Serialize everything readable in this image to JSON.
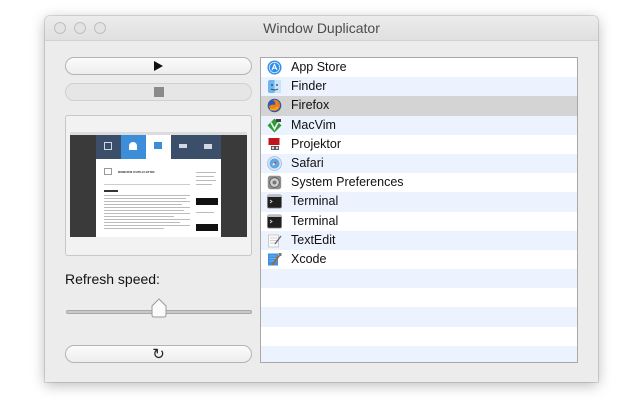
{
  "window": {
    "title": "Window Duplicator"
  },
  "controls": {
    "play_icon": "play-icon",
    "stop_icon": "stop-icon",
    "refresh_icon": "refresh-icon",
    "refresh_label": "Refresh speed:",
    "refresh_speed_fraction": 0.5
  },
  "preview": {
    "heading": "WINDOW DUPLICATOR"
  },
  "apps": {
    "items": [
      {
        "name": "App Store",
        "icon": "app-store-icon",
        "selected": false
      },
      {
        "name": "Finder",
        "icon": "finder-icon",
        "selected": false
      },
      {
        "name": "Firefox",
        "icon": "firefox-icon",
        "selected": true
      },
      {
        "name": "MacVim",
        "icon": "macvim-icon",
        "selected": false
      },
      {
        "name": "Projektor",
        "icon": "projektor-icon",
        "selected": false
      },
      {
        "name": "Safari",
        "icon": "safari-icon",
        "selected": false
      },
      {
        "name": "System Preferences",
        "icon": "system-preferences-icon",
        "selected": false
      },
      {
        "name": "Terminal",
        "icon": "terminal-icon",
        "selected": false
      },
      {
        "name": "Terminal",
        "icon": "terminal-icon",
        "selected": false
      },
      {
        "name": "TextEdit",
        "icon": "textedit-icon",
        "selected": false
      },
      {
        "name": "Xcode",
        "icon": "xcode-icon",
        "selected": false
      }
    ]
  },
  "colors": {
    "selection": "#d4d4d4",
    "stripe": "#edf3fe"
  }
}
